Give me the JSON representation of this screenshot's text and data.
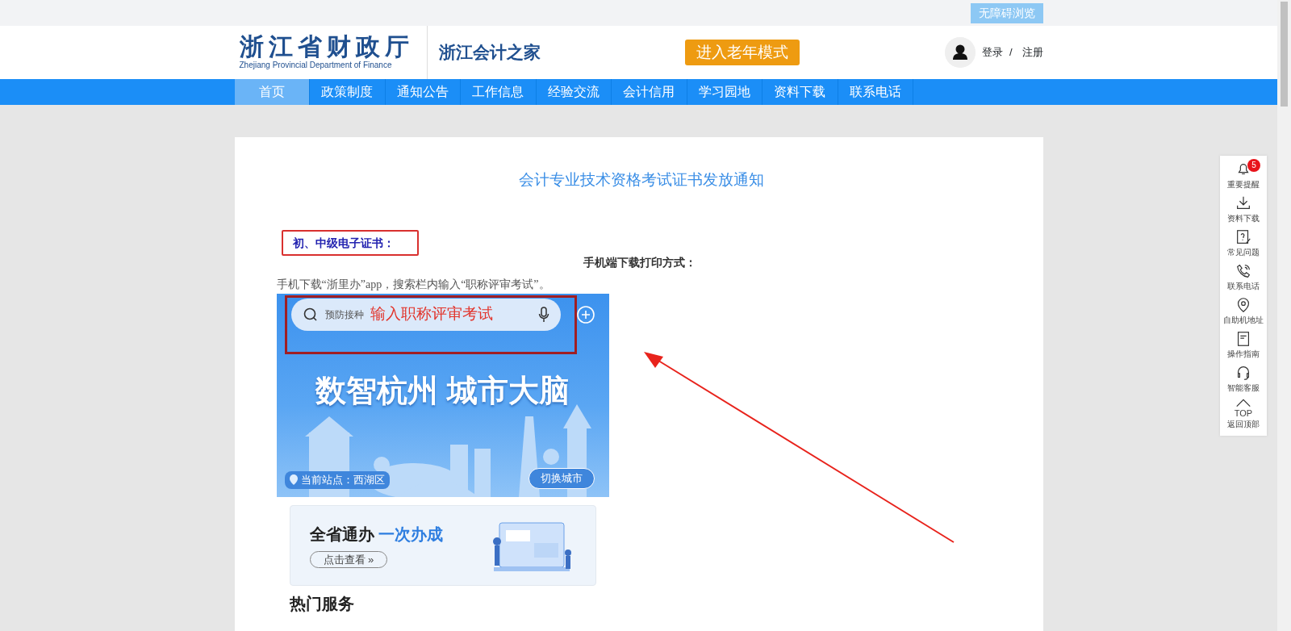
{
  "top_bar": {
    "accessibility_button": "无障碍浏览"
  },
  "header": {
    "logo_title": "浙江省财政厅",
    "logo_subtitle": "Zhejiang Provincial Department of Finance",
    "site_name": "浙江会计之家",
    "elder_mode_button": "进入老年模式",
    "login": "登录",
    "separator": "/",
    "register": "注册"
  },
  "nav": [
    {
      "label": "首页",
      "selected": true
    },
    {
      "label": "政策制度",
      "selected": false
    },
    {
      "label": "通知公告",
      "selected": false
    },
    {
      "label": "工作信息",
      "selected": false
    },
    {
      "label": "经验交流",
      "selected": false
    },
    {
      "label": "会计信用",
      "selected": false
    },
    {
      "label": "学习园地",
      "selected": false
    },
    {
      "label": "资料下载",
      "selected": false
    },
    {
      "label": "联系电话",
      "selected": false
    }
  ],
  "article": {
    "title": "会计专业技术资格考试证书发放通知",
    "section_label": "初、中级电子证书：",
    "subheading": "手机端下载打印方式：",
    "instruction": "手机下载“浙里办”app，搜索栏内输入“职称评审考试”。",
    "app_screenshot": {
      "search_hint": "预防接种",
      "search_annotation": "输入职称评审考试",
      "banner_title": "数智杭州 城市大脑",
      "current_site": "当前站点：西湖区",
      "switch_city_button": "切换城市",
      "promo_title": "全省通办",
      "promo_highlight": "一次办成",
      "promo_button": "点击查看 »",
      "section_heading": "热门服务"
    }
  },
  "side_toolbar": [
    {
      "kind": "bell",
      "label": "重要提醒",
      "badge": "5"
    },
    {
      "kind": "download",
      "label": "资料下载"
    },
    {
      "kind": "question",
      "label": "常见问题"
    },
    {
      "kind": "phone",
      "label": "联系电话"
    },
    {
      "kind": "location",
      "label": "自助机地址"
    },
    {
      "kind": "guide",
      "label": "操作指南"
    },
    {
      "kind": "headset",
      "label": "智能客服"
    },
    {
      "kind": "top",
      "top_text": "TOP",
      "label": "返回顶部"
    }
  ]
}
